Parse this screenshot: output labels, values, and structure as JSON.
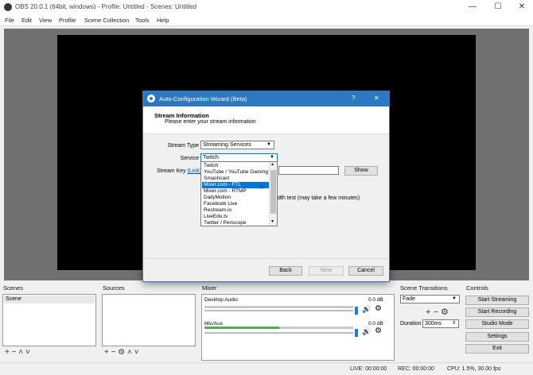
{
  "window": {
    "title": "OBS 20.0.1 (64bit, windows) - Profile: Untitled - Scenes: Untitled",
    "minimize": "—",
    "maximize": "☐",
    "close": "✕"
  },
  "menu": [
    "File",
    "Edit",
    "View",
    "Profile",
    "Scene Collection",
    "Tools",
    "Help"
  ],
  "docks": {
    "scenes": {
      "title": "Scenes",
      "items": [
        "Scene"
      ],
      "toolbar": "+ − ˄ ˅"
    },
    "sources": {
      "title": "Sources",
      "toolbar": "+ − ⚙ ˄ ˅"
    },
    "mixer": {
      "title": "Mixer",
      "channels": [
        {
          "name": "Desktop Audio",
          "db": "0.0 dB",
          "level": 0.0
        },
        {
          "name": "Mic/Aux",
          "db": "0.0 dB",
          "level": 0.5
        }
      ]
    },
    "transitions": {
      "title": "Scene Transitions",
      "selected": "Fade",
      "duration_label": "Duration",
      "duration_value": "300ms"
    },
    "controls": {
      "title": "Controls",
      "buttons": [
        "Start Streaming",
        "Start Recording",
        "Studio Mode",
        "Settings",
        "Exit"
      ]
    }
  },
  "status": {
    "live": "LIVE: 00:00:00",
    "rec": "REC: 00:00:00",
    "cpu": "CPU: 1.5%, 30.00 fps"
  },
  "dialog": {
    "title": "Auto-Configuration Wizard (Beta)",
    "help": "?",
    "close": "✕",
    "header_title": "Stream Information",
    "header_subtitle": "Please enter your stream information",
    "stream_type_label": "Stream Type",
    "stream_type_value": "Streaming Services",
    "service_label": "Service",
    "service_value": "Twitch",
    "stream_key_label": "Stream Key",
    "stream_key_link": "(Link)",
    "show_button": "Show",
    "bandwidth_text": "dth test (may take a few minutes)",
    "service_options": [
      "Twitch",
      "YouTube / YouTube Gaming",
      "Smashcast",
      "Mixer.com - FTL",
      "Mixer.com - RTMP",
      "DailyMotion",
      "Facebook Live",
      "Restream.io",
      "LiveEdu.tv",
      "Twitter / Periscope"
    ],
    "highlighted_option": "Mixer.com - FTL",
    "back_button": "Back",
    "next_button": "Next",
    "cancel_button": "Cancel"
  }
}
